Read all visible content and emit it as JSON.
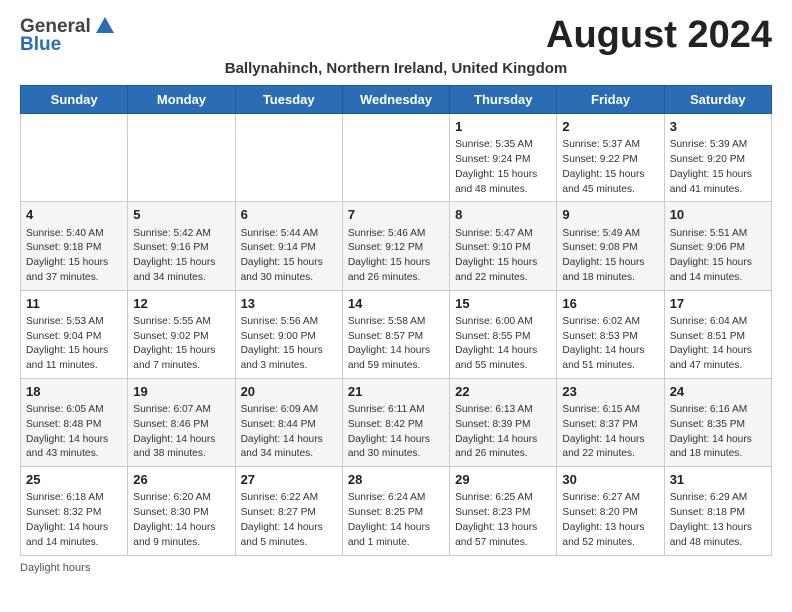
{
  "header": {
    "logo_general": "General",
    "logo_blue": "Blue",
    "month_year": "August 2024",
    "location": "Ballynahinch, Northern Ireland, United Kingdom"
  },
  "days_of_week": [
    "Sunday",
    "Monday",
    "Tuesday",
    "Wednesday",
    "Thursday",
    "Friday",
    "Saturday"
  ],
  "weeks": [
    [
      {
        "day": "",
        "info": ""
      },
      {
        "day": "",
        "info": ""
      },
      {
        "day": "",
        "info": ""
      },
      {
        "day": "",
        "info": ""
      },
      {
        "day": "1",
        "info": "Sunrise: 5:35 AM\nSunset: 9:24 PM\nDaylight: 15 hours\nand 48 minutes."
      },
      {
        "day": "2",
        "info": "Sunrise: 5:37 AM\nSunset: 9:22 PM\nDaylight: 15 hours\nand 45 minutes."
      },
      {
        "day": "3",
        "info": "Sunrise: 5:39 AM\nSunset: 9:20 PM\nDaylight: 15 hours\nand 41 minutes."
      }
    ],
    [
      {
        "day": "4",
        "info": "Sunrise: 5:40 AM\nSunset: 9:18 PM\nDaylight: 15 hours\nand 37 minutes."
      },
      {
        "day": "5",
        "info": "Sunrise: 5:42 AM\nSunset: 9:16 PM\nDaylight: 15 hours\nand 34 minutes."
      },
      {
        "day": "6",
        "info": "Sunrise: 5:44 AM\nSunset: 9:14 PM\nDaylight: 15 hours\nand 30 minutes."
      },
      {
        "day": "7",
        "info": "Sunrise: 5:46 AM\nSunset: 9:12 PM\nDaylight: 15 hours\nand 26 minutes."
      },
      {
        "day": "8",
        "info": "Sunrise: 5:47 AM\nSunset: 9:10 PM\nDaylight: 15 hours\nand 22 minutes."
      },
      {
        "day": "9",
        "info": "Sunrise: 5:49 AM\nSunset: 9:08 PM\nDaylight: 15 hours\nand 18 minutes."
      },
      {
        "day": "10",
        "info": "Sunrise: 5:51 AM\nSunset: 9:06 PM\nDaylight: 15 hours\nand 14 minutes."
      }
    ],
    [
      {
        "day": "11",
        "info": "Sunrise: 5:53 AM\nSunset: 9:04 PM\nDaylight: 15 hours\nand 11 minutes."
      },
      {
        "day": "12",
        "info": "Sunrise: 5:55 AM\nSunset: 9:02 PM\nDaylight: 15 hours\nand 7 minutes."
      },
      {
        "day": "13",
        "info": "Sunrise: 5:56 AM\nSunset: 9:00 PM\nDaylight: 15 hours\nand 3 minutes."
      },
      {
        "day": "14",
        "info": "Sunrise: 5:58 AM\nSunset: 8:57 PM\nDaylight: 14 hours\nand 59 minutes."
      },
      {
        "day": "15",
        "info": "Sunrise: 6:00 AM\nSunset: 8:55 PM\nDaylight: 14 hours\nand 55 minutes."
      },
      {
        "day": "16",
        "info": "Sunrise: 6:02 AM\nSunset: 8:53 PM\nDaylight: 14 hours\nand 51 minutes."
      },
      {
        "day": "17",
        "info": "Sunrise: 6:04 AM\nSunset: 8:51 PM\nDaylight: 14 hours\nand 47 minutes."
      }
    ],
    [
      {
        "day": "18",
        "info": "Sunrise: 6:05 AM\nSunset: 8:48 PM\nDaylight: 14 hours\nand 43 minutes."
      },
      {
        "day": "19",
        "info": "Sunrise: 6:07 AM\nSunset: 8:46 PM\nDaylight: 14 hours\nand 38 minutes."
      },
      {
        "day": "20",
        "info": "Sunrise: 6:09 AM\nSunset: 8:44 PM\nDaylight: 14 hours\nand 34 minutes."
      },
      {
        "day": "21",
        "info": "Sunrise: 6:11 AM\nSunset: 8:42 PM\nDaylight: 14 hours\nand 30 minutes."
      },
      {
        "day": "22",
        "info": "Sunrise: 6:13 AM\nSunset: 8:39 PM\nDaylight: 14 hours\nand 26 minutes."
      },
      {
        "day": "23",
        "info": "Sunrise: 6:15 AM\nSunset: 8:37 PM\nDaylight: 14 hours\nand 22 minutes."
      },
      {
        "day": "24",
        "info": "Sunrise: 6:16 AM\nSunset: 8:35 PM\nDaylight: 14 hours\nand 18 minutes."
      }
    ],
    [
      {
        "day": "25",
        "info": "Sunrise: 6:18 AM\nSunset: 8:32 PM\nDaylight: 14 hours\nand 14 minutes."
      },
      {
        "day": "26",
        "info": "Sunrise: 6:20 AM\nSunset: 8:30 PM\nDaylight: 14 hours\nand 9 minutes."
      },
      {
        "day": "27",
        "info": "Sunrise: 6:22 AM\nSunset: 8:27 PM\nDaylight: 14 hours\nand 5 minutes."
      },
      {
        "day": "28",
        "info": "Sunrise: 6:24 AM\nSunset: 8:25 PM\nDaylight: 14 hours\nand 1 minute."
      },
      {
        "day": "29",
        "info": "Sunrise: 6:25 AM\nSunset: 8:23 PM\nDaylight: 13 hours\nand 57 minutes."
      },
      {
        "day": "30",
        "info": "Sunrise: 6:27 AM\nSunset: 8:20 PM\nDaylight: 13 hours\nand 52 minutes."
      },
      {
        "day": "31",
        "info": "Sunrise: 6:29 AM\nSunset: 8:18 PM\nDaylight: 13 hours\nand 48 minutes."
      }
    ]
  ],
  "footer": {
    "daylight_label": "Daylight hours"
  }
}
